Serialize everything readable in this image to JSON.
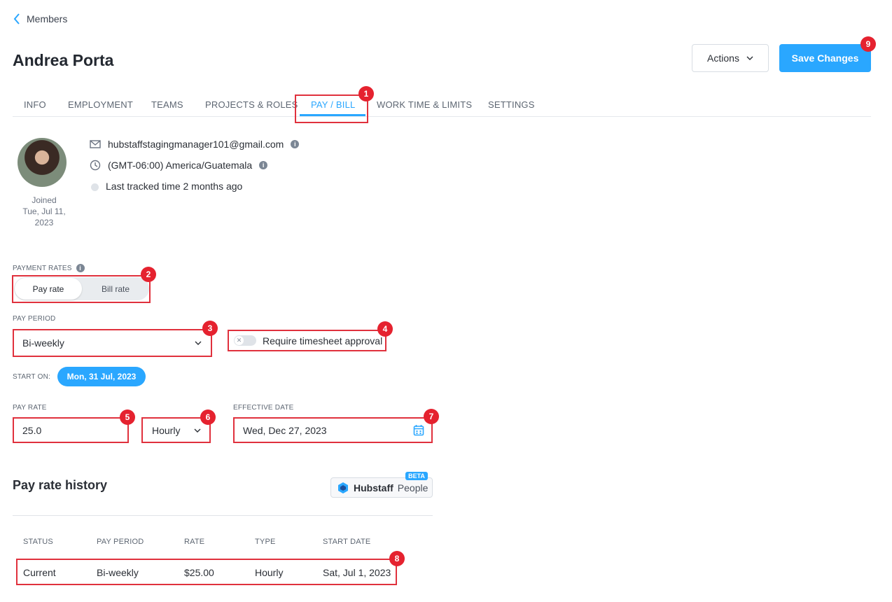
{
  "nav": {
    "back_label": "Members"
  },
  "header": {
    "title": "Andrea Porta",
    "actions_label": "Actions",
    "save_label": "Save Changes"
  },
  "tabs": [
    {
      "label": "INFO"
    },
    {
      "label": "EMPLOYMENT"
    },
    {
      "label": "TEAMS"
    },
    {
      "label": "PROJECTS & ROLES"
    },
    {
      "label": "PAY / BILL",
      "active": true
    },
    {
      "label": "WORK TIME & LIMITS"
    },
    {
      "label": "SETTINGS"
    }
  ],
  "profile": {
    "joined_label": "Joined",
    "joined_date": "Tue, Jul 11, 2023",
    "email": "hubstaffstagingmanager101@gmail.com",
    "timezone": "(GMT-06:00) America/Guatemala",
    "last_tracked": "Last tracked time 2 months ago"
  },
  "payment_rates": {
    "label": "PAYMENT RATES",
    "options": [
      "Pay rate",
      "Bill rate"
    ],
    "selected": "Pay rate"
  },
  "pay_period": {
    "label": "PAY PERIOD",
    "value": "Bi-weekly",
    "require_approval_label": "Require timesheet approval",
    "require_approval": false
  },
  "start_on": {
    "label": "START ON:",
    "value": "Mon, 31 Jul, 2023"
  },
  "pay_rate": {
    "label": "PAY RATE",
    "value": "25.0",
    "type": "Hourly"
  },
  "effective_date": {
    "label": "EFFECTIVE DATE",
    "value": "Wed, Dec 27, 2023"
  },
  "history": {
    "title": "Pay rate history",
    "logo_brand": "Hubstaff",
    "logo_product": "People",
    "beta_label": "BETA",
    "columns": [
      "STATUS",
      "PAY PERIOD",
      "RATE",
      "TYPE",
      "START DATE"
    ],
    "rows": [
      [
        "Current",
        "Bi-weekly",
        "$25.00",
        "Hourly",
        "Sat, Jul 1, 2023"
      ]
    ]
  },
  "annotations": [
    "1",
    "2",
    "3",
    "4",
    "5",
    "6",
    "7",
    "8",
    "9"
  ],
  "colors": {
    "accent": "#2aa7ff",
    "annotation": "#e5222f"
  }
}
